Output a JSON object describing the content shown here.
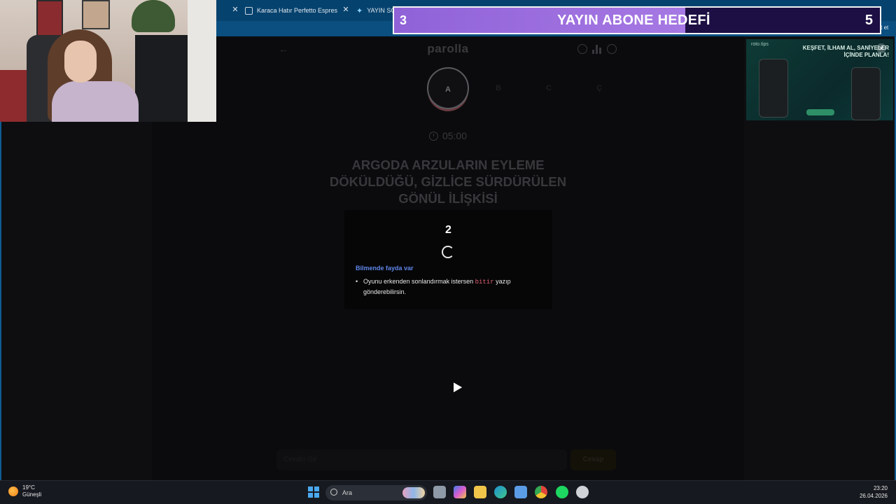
{
  "browser": {
    "tabs": [
      {
        "title": "Karaca Hatır Perfetto Espresso ve"
      },
      {
        "title": "YAYIN SO"
      }
    ],
    "sohbet_label": "Sohbet et"
  },
  "goal_overlay": {
    "current": "3",
    "title": "YAYIN ABONE HEDEFİ",
    "target": "5",
    "progress": 0.6,
    "colors": {
      "fill": "#9a6de0",
      "empty": "#1d0f44"
    }
  },
  "app": {
    "brand": "parolla",
    "letters": [
      {
        "char": "A",
        "state": "active"
      },
      {
        "char": "B",
        "state": "idle"
      },
      {
        "char": "C",
        "state": "idle"
      },
      {
        "char": "Ç",
        "state": "idle"
      }
    ],
    "timer": "05:00",
    "question_lines": [
      "ARGODA ARZULARIN EYLEME",
      "DÖKÜLDÜĞÜ, GİZLİCE SÜRDÜRÜLEN",
      "GÖNÜL İLİŞKİSİ"
    ],
    "input_placeholder": "Cevabı Gir",
    "send_label": "Cevap"
  },
  "modal": {
    "countdown": "2",
    "tip_title": "Bilmende fayda var",
    "tip_before": "Oyunu erkenden sonlandırmak istersen",
    "tip_code": "bitir",
    "tip_after": "yazıp gönderebilirsin."
  },
  "ad": {
    "brand": "roto.tips",
    "headline": "KEŞFET, İLHAM AL, SANİYELER İÇİNDE PLANLA!"
  },
  "taskbar": {
    "weather_temp": "19°C",
    "weather_desc": "Güneşli",
    "search_label": "Ara",
    "time": "23:20",
    "date": "26.04.2026"
  },
  "icons": [
    "close-icon",
    "back-arrow-icon",
    "info-icon",
    "stats-icon",
    "profile-icon",
    "clock-icon",
    "windows-start-icon",
    "search-icon",
    "file-explorer-icon",
    "edge-icon",
    "store-icon",
    "chrome-icon",
    "spotify-icon"
  ]
}
